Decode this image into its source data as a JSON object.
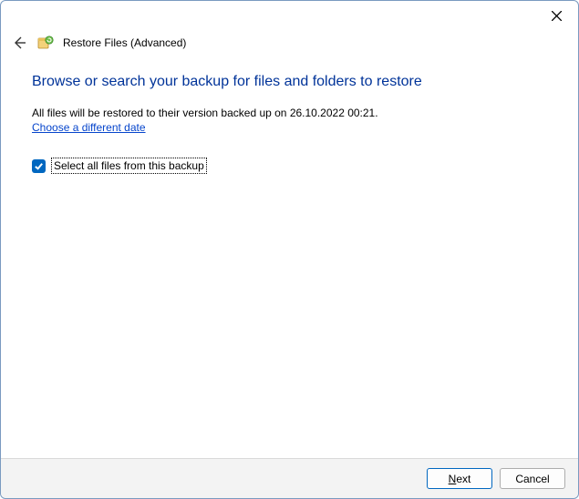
{
  "window": {
    "title": "Restore Files (Advanced)"
  },
  "content": {
    "heading": "Browse or search your backup for files and folders to restore",
    "info_prefix": "All files will be restored to their version backed up on ",
    "backup_date": "26.10.2022 00:21",
    "info_suffix": ".",
    "change_date_link": "Choose a different date",
    "select_all_label": "Select all files from this backup",
    "select_all_checked": true
  },
  "footer": {
    "next_rest": "ext",
    "cancel": "Cancel"
  },
  "icons": {
    "close": "close-icon",
    "back": "back-arrow-icon",
    "app": "restore-files-icon",
    "check": "checkmark-icon"
  }
}
